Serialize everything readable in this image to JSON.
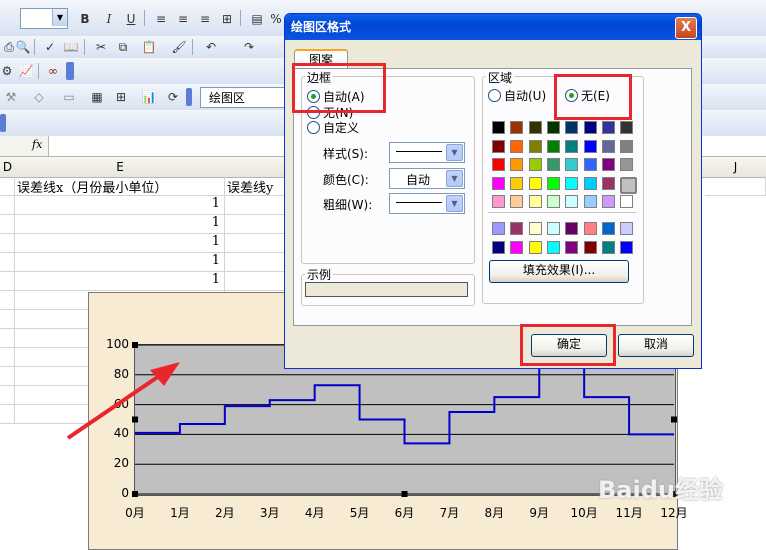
{
  "toolbar": {
    "bold": "B",
    "italic": "I",
    "underline": "U",
    "percent": "%",
    "plot_area_combo": "绘图区",
    "formula_fx": "fx"
  },
  "sheet": {
    "columns": [
      "D",
      "E",
      "J"
    ],
    "header_e": "误差线x（月份最小单位）",
    "header_f": "误差线y",
    "values_e": [
      "1",
      "1",
      "1",
      "1",
      "1"
    ]
  },
  "dialog": {
    "title": "绘图区格式",
    "close": "X",
    "tab": "图案",
    "border_group": "边框",
    "border_options": [
      "自动(A)",
      "无(N)",
      "自定义"
    ],
    "style_label": "样式(S):",
    "color_label": "颜色(C):",
    "color_value": "自动",
    "weight_label": "粗细(W):",
    "area_group": "区域",
    "area_auto": "自动(U)",
    "area_none": "无(E)",
    "fill_effects": "填充效果(I)...",
    "sample_group": "示例",
    "ok": "确定",
    "cancel": "取消",
    "palette_main": [
      [
        "#000000",
        "#993300",
        "#333300",
        "#003300",
        "#003366",
        "#000080",
        "#333399",
        "#333333"
      ],
      [
        "#800000",
        "#FF6600",
        "#808000",
        "#008000",
        "#008080",
        "#0000FF",
        "#666699",
        "#808080"
      ],
      [
        "#FF0000",
        "#FF9900",
        "#99CC00",
        "#339966",
        "#33CCCC",
        "#3366FF",
        "#800080",
        "#969696"
      ],
      [
        "#FF00FF",
        "#FFCC00",
        "#FFFF00",
        "#00FF00",
        "#00FFFF",
        "#00CCFF",
        "#993366",
        "#C0C0C0"
      ],
      [
        "#FF99CC",
        "#FFCC99",
        "#FFFF99",
        "#CCFFCC",
        "#CCFFFF",
        "#99CCFF",
        "#CC99FF",
        "#FFFFFF"
      ]
    ],
    "palette_chart": [
      [
        "#9999FF",
        "#993366",
        "#FFFFCC",
        "#CCFFFF",
        "#660066",
        "#FF8080",
        "#0066CC",
        "#CCCCFF"
      ],
      [
        "#000080",
        "#FF00FF",
        "#FFFF00",
        "#00FFFF",
        "#800080",
        "#800000",
        "#008080",
        "#0000FF"
      ]
    ]
  },
  "chart_data": {
    "type": "line",
    "categories": [
      "0月",
      "1月",
      "2月",
      "3月",
      "4月",
      "5月",
      "6月",
      "7月",
      "8月",
      "9月",
      "10月",
      "11月",
      "12月"
    ],
    "y_ticks": [
      "0",
      "20",
      "40",
      "60",
      "80",
      "100"
    ],
    "ylim": [
      0,
      100
    ],
    "step_levels": [
      41,
      47,
      59,
      63,
      73,
      50,
      34,
      55,
      65,
      100,
      65,
      40
    ],
    "colors": {
      "line": "#0000cc",
      "plot_bg": "#c0c0c0",
      "chart_bg": "#f7ecd3"
    }
  },
  "watermark": "Baidu经验"
}
